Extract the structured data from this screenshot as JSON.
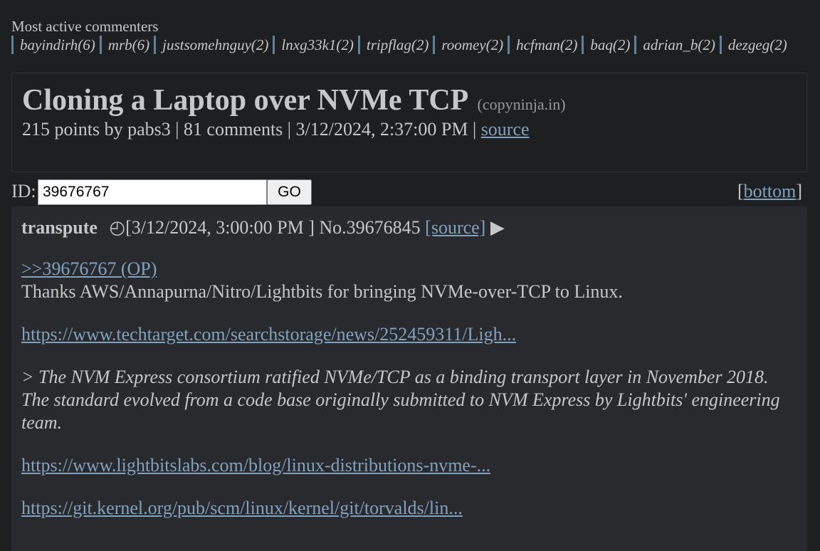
{
  "commenters": {
    "title": "Most active commenters",
    "items": [
      "bayindirh(6)",
      "mrb(6)",
      "justsomehnguy(2)",
      "lnxg33k1(2)",
      "tripflag(2)",
      "roomey(2)",
      "hcfman(2)",
      "baq(2)",
      "adrian_b(2)",
      "dezgeg(2)"
    ]
  },
  "story": {
    "title": "Cloning a Laptop over NVMe TCP",
    "domain": "(copyninja.in)",
    "meta": "215 points by pabs3 | 81 comments | 3/12/2024, 2:37:00 PM | ",
    "source_label": "source"
  },
  "id_form": {
    "label": "ID:",
    "value": "39676767",
    "go_label": "GO",
    "bottom_open": "[",
    "bottom_label": "bottom",
    "bottom_close": "]"
  },
  "comment": {
    "author": "transpute",
    "clock_glyph": "◴",
    "timestamp": "[3/12/2024, 3:00:00 PM ]",
    "number": "No.39676845",
    "source_label": "[source]",
    "arrow_glyph": "▶",
    "reply_ref": ">>39676767 (OP)",
    "text1": "Thanks AWS/Annapurna/Nitro/Lightbits for bringing NVMe-over-TCP to Linux.",
    "link1": "https://www.techtarget.com/searchstorage/news/252459311/Ligh...",
    "quote": "> The NVM Express consortium ratified NVMe/TCP as a binding transport layer in November 2018. The standard evolved from a code base originally submitted to NVM Express by Lightbits' engineering team.",
    "link2": "https://www.lightbitslabs.com/blog/linux-distributions-nvme-...",
    "link3": "https://git.kernel.org/pub/scm/linux/kernel/git/torvalds/lin..."
  }
}
